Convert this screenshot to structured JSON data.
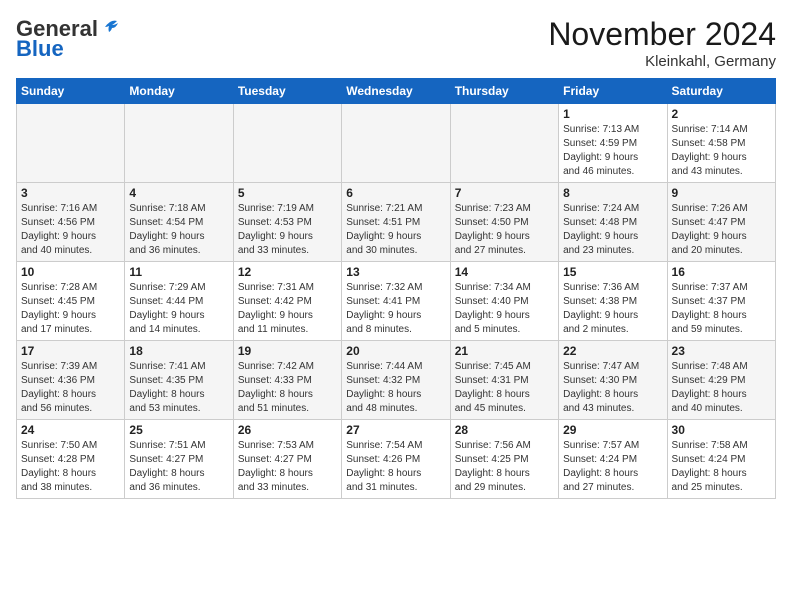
{
  "logo": {
    "general": "General",
    "blue": "Blue"
  },
  "header": {
    "month": "November 2024",
    "location": "Kleinkahl, Germany"
  },
  "weekdays": [
    "Sunday",
    "Monday",
    "Tuesday",
    "Wednesday",
    "Thursday",
    "Friday",
    "Saturday"
  ],
  "weeks": [
    [
      {
        "day": "",
        "info": ""
      },
      {
        "day": "",
        "info": ""
      },
      {
        "day": "",
        "info": ""
      },
      {
        "day": "",
        "info": ""
      },
      {
        "day": "",
        "info": ""
      },
      {
        "day": "1",
        "info": "Sunrise: 7:13 AM\nSunset: 4:59 PM\nDaylight: 9 hours\nand 46 minutes."
      },
      {
        "day": "2",
        "info": "Sunrise: 7:14 AM\nSunset: 4:58 PM\nDaylight: 9 hours\nand 43 minutes."
      }
    ],
    [
      {
        "day": "3",
        "info": "Sunrise: 7:16 AM\nSunset: 4:56 PM\nDaylight: 9 hours\nand 40 minutes."
      },
      {
        "day": "4",
        "info": "Sunrise: 7:18 AM\nSunset: 4:54 PM\nDaylight: 9 hours\nand 36 minutes."
      },
      {
        "day": "5",
        "info": "Sunrise: 7:19 AM\nSunset: 4:53 PM\nDaylight: 9 hours\nand 33 minutes."
      },
      {
        "day": "6",
        "info": "Sunrise: 7:21 AM\nSunset: 4:51 PM\nDaylight: 9 hours\nand 30 minutes."
      },
      {
        "day": "7",
        "info": "Sunrise: 7:23 AM\nSunset: 4:50 PM\nDaylight: 9 hours\nand 27 minutes."
      },
      {
        "day": "8",
        "info": "Sunrise: 7:24 AM\nSunset: 4:48 PM\nDaylight: 9 hours\nand 23 minutes."
      },
      {
        "day": "9",
        "info": "Sunrise: 7:26 AM\nSunset: 4:47 PM\nDaylight: 9 hours\nand 20 minutes."
      }
    ],
    [
      {
        "day": "10",
        "info": "Sunrise: 7:28 AM\nSunset: 4:45 PM\nDaylight: 9 hours\nand 17 minutes."
      },
      {
        "day": "11",
        "info": "Sunrise: 7:29 AM\nSunset: 4:44 PM\nDaylight: 9 hours\nand 14 minutes."
      },
      {
        "day": "12",
        "info": "Sunrise: 7:31 AM\nSunset: 4:42 PM\nDaylight: 9 hours\nand 11 minutes."
      },
      {
        "day": "13",
        "info": "Sunrise: 7:32 AM\nSunset: 4:41 PM\nDaylight: 9 hours\nand 8 minutes."
      },
      {
        "day": "14",
        "info": "Sunrise: 7:34 AM\nSunset: 4:40 PM\nDaylight: 9 hours\nand 5 minutes."
      },
      {
        "day": "15",
        "info": "Sunrise: 7:36 AM\nSunset: 4:38 PM\nDaylight: 9 hours\nand 2 minutes."
      },
      {
        "day": "16",
        "info": "Sunrise: 7:37 AM\nSunset: 4:37 PM\nDaylight: 8 hours\nand 59 minutes."
      }
    ],
    [
      {
        "day": "17",
        "info": "Sunrise: 7:39 AM\nSunset: 4:36 PM\nDaylight: 8 hours\nand 56 minutes."
      },
      {
        "day": "18",
        "info": "Sunrise: 7:41 AM\nSunset: 4:35 PM\nDaylight: 8 hours\nand 53 minutes."
      },
      {
        "day": "19",
        "info": "Sunrise: 7:42 AM\nSunset: 4:33 PM\nDaylight: 8 hours\nand 51 minutes."
      },
      {
        "day": "20",
        "info": "Sunrise: 7:44 AM\nSunset: 4:32 PM\nDaylight: 8 hours\nand 48 minutes."
      },
      {
        "day": "21",
        "info": "Sunrise: 7:45 AM\nSunset: 4:31 PM\nDaylight: 8 hours\nand 45 minutes."
      },
      {
        "day": "22",
        "info": "Sunrise: 7:47 AM\nSunset: 4:30 PM\nDaylight: 8 hours\nand 43 minutes."
      },
      {
        "day": "23",
        "info": "Sunrise: 7:48 AM\nSunset: 4:29 PM\nDaylight: 8 hours\nand 40 minutes."
      }
    ],
    [
      {
        "day": "24",
        "info": "Sunrise: 7:50 AM\nSunset: 4:28 PM\nDaylight: 8 hours\nand 38 minutes."
      },
      {
        "day": "25",
        "info": "Sunrise: 7:51 AM\nSunset: 4:27 PM\nDaylight: 8 hours\nand 36 minutes."
      },
      {
        "day": "26",
        "info": "Sunrise: 7:53 AM\nSunset: 4:27 PM\nDaylight: 8 hours\nand 33 minutes."
      },
      {
        "day": "27",
        "info": "Sunrise: 7:54 AM\nSunset: 4:26 PM\nDaylight: 8 hours\nand 31 minutes."
      },
      {
        "day": "28",
        "info": "Sunrise: 7:56 AM\nSunset: 4:25 PM\nDaylight: 8 hours\nand 29 minutes."
      },
      {
        "day": "29",
        "info": "Sunrise: 7:57 AM\nSunset: 4:24 PM\nDaylight: 8 hours\nand 27 minutes."
      },
      {
        "day": "30",
        "info": "Sunrise: 7:58 AM\nSunset: 4:24 PM\nDaylight: 8 hours\nand 25 minutes."
      }
    ]
  ]
}
